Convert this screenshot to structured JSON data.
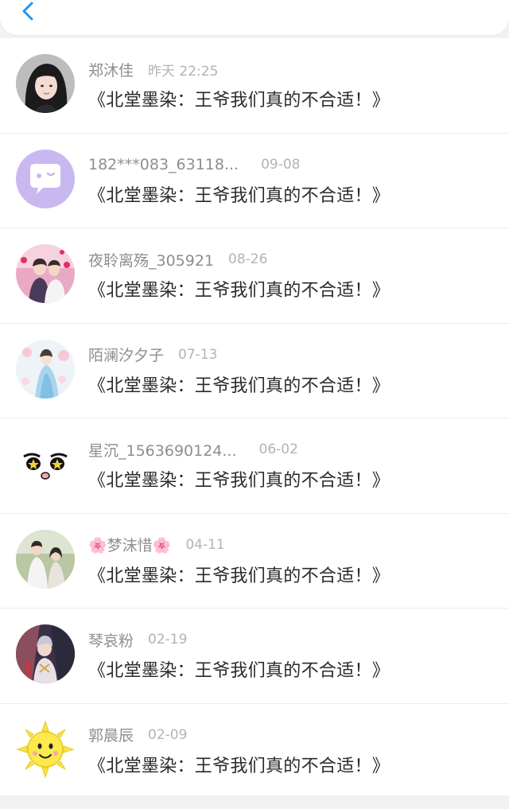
{
  "header": {
    "back_icon": "chevron-left-icon",
    "accent": "#2196f3"
  },
  "list": {
    "items": [
      {
        "name": "郑沐佳",
        "date": "昨天 22:25",
        "book": "《北堂墨染：王爷我们真的不合适！》",
        "avatar": "photo-girl-dark-hair"
      },
      {
        "name": "182***083_63118...",
        "date": "09-08",
        "book": "《北堂墨染：王爷我们真的不合适！》",
        "avatar": "purple-chat-bubble"
      },
      {
        "name": "夜聆离殇_305921",
        "date": "08-26",
        "book": "《北堂墨染：王爷我们真的不合适！》",
        "avatar": "photo-couple-hearts"
      },
      {
        "name": "陌澜汐夕子",
        "date": "07-13",
        "book": "《北堂墨染：王爷我们真的不合适！》",
        "avatar": "photo-girl-blossoms"
      },
      {
        "name": "星沉_1563690124...",
        "date": "06-02",
        "book": "《北堂墨染：王爷我们真的不合适！》",
        "avatar": "star-eyes-face"
      },
      {
        "name": "🌸梦沫惜🌸",
        "date": "04-11",
        "book": "《北堂墨染：王爷我们真的不合适！》",
        "avatar": "photo-couple-outdoor"
      },
      {
        "name": "琴哀粉",
        "date": "02-19",
        "book": "《北堂墨染：王爷我们真的不合适！》",
        "avatar": "anime-character"
      },
      {
        "name": "郭晨辰",
        "date": "02-09",
        "book": "《北堂墨染：王爷我们真的不合适！》",
        "avatar": "cartoon-sun"
      }
    ]
  }
}
